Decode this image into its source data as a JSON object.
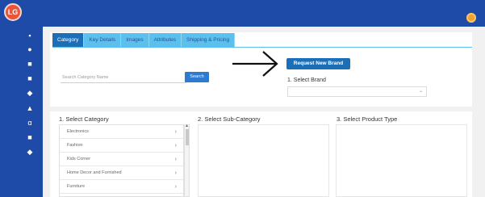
{
  "app": {
    "logo_text": "LG",
    "colors": {
      "primary": "#1e4aa8",
      "tab_active": "#1b6fb8",
      "tab": "#5bc0ee",
      "button": "#2d7ad1"
    }
  },
  "sidebar": {
    "items": [
      {
        "icon": "dashboard-icon",
        "glyph": "▪"
      },
      {
        "icon": "basket-icon",
        "glyph": "●"
      },
      {
        "icon": "copy-icon",
        "glyph": "■"
      },
      {
        "icon": "truck-icon",
        "glyph": "■"
      },
      {
        "icon": "shield-icon",
        "glyph": "◆"
      },
      {
        "icon": "chart-icon",
        "glyph": "▲"
      },
      {
        "icon": "rupee-icon",
        "glyph": "α"
      },
      {
        "icon": "delivery-icon",
        "glyph": "■"
      },
      {
        "icon": "support-icon",
        "glyph": "◆"
      }
    ]
  },
  "tabs": [
    {
      "label": "Category"
    },
    {
      "label": "Key Details"
    },
    {
      "label": "Images"
    },
    {
      "label": "Attributes"
    },
    {
      "label": "Shipping & Pricing"
    }
  ],
  "search": {
    "placeholder": "Search Category Name",
    "button_label": "Search"
  },
  "brand": {
    "request_button": "Request New Brand",
    "label": "1. Select Brand"
  },
  "sections": {
    "category": "1. Select Category",
    "sub_category": "2. Select Sub-Category",
    "product_type": "3. Select Product Type"
  },
  "categories": [
    {
      "label": "Electronics"
    },
    {
      "label": "Fashion"
    },
    {
      "label": "Kids Corner"
    },
    {
      "label": "Home Decor and Furnished"
    },
    {
      "label": "Furniture"
    }
  ]
}
